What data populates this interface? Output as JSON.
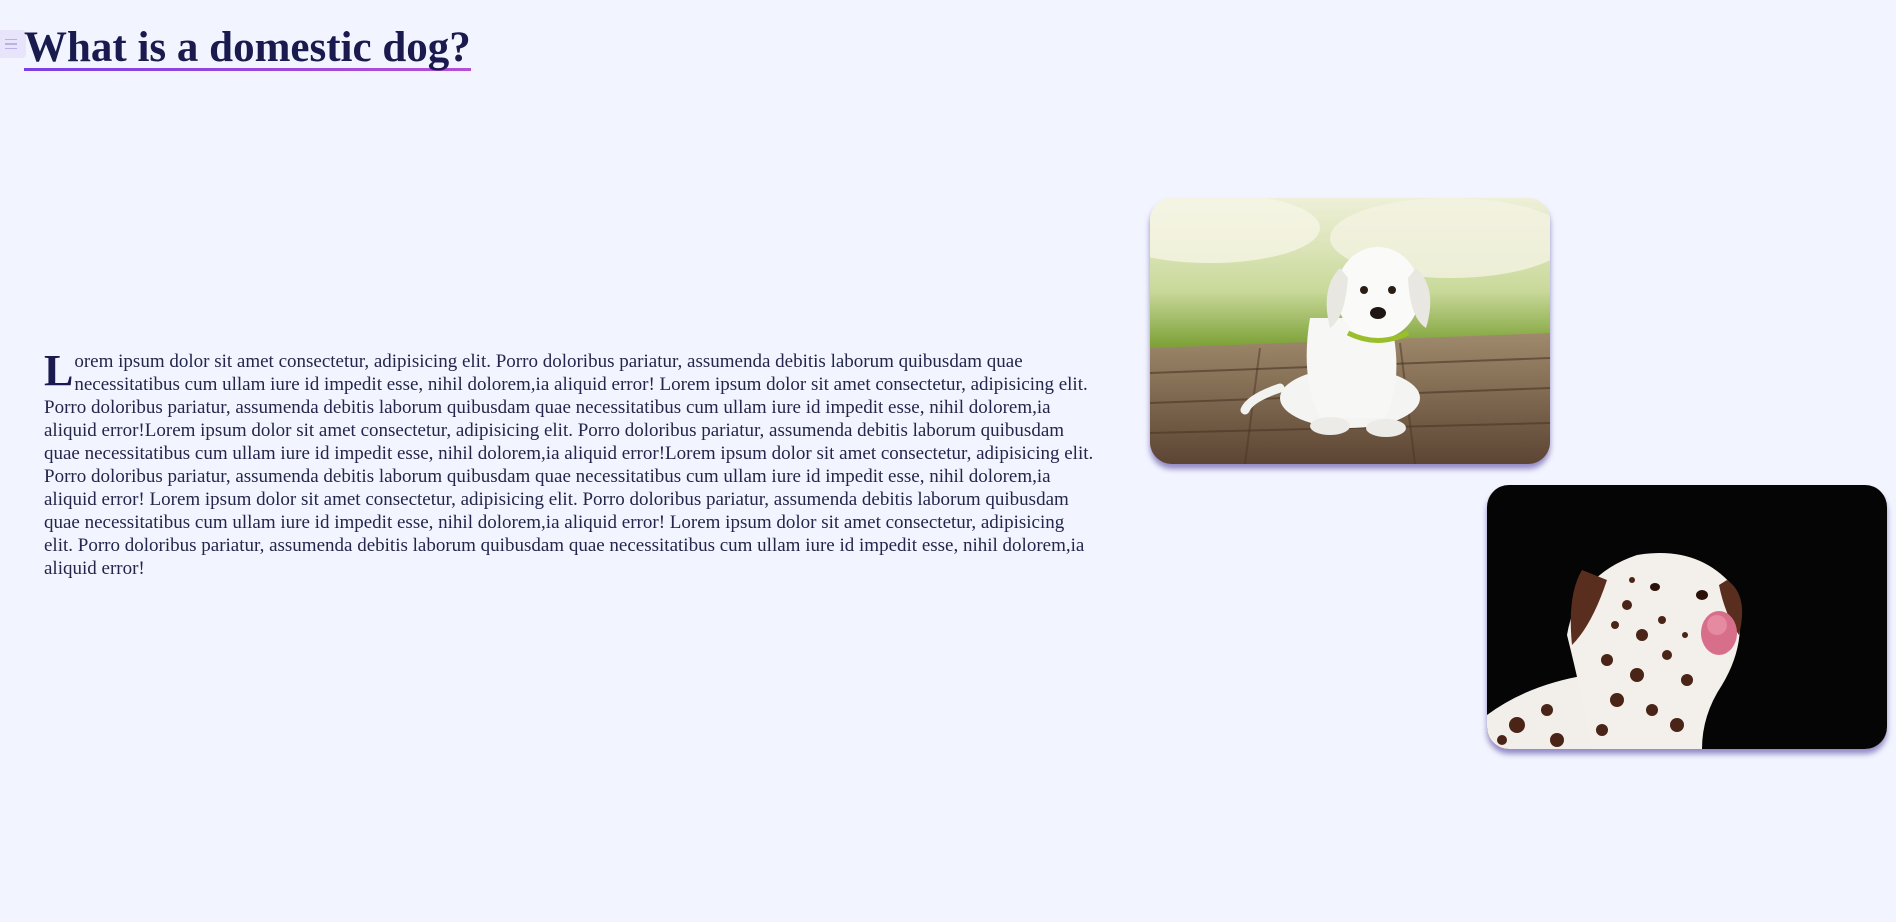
{
  "header": {
    "title": "What is a domestic dog?",
    "menu_icon": "hamburger-menu-icon"
  },
  "article": {
    "dropcap": "L",
    "paragraph": "orem ipsum dolor sit amet consectetur, adipisicing elit. Porro doloribus pariatur, assumenda debitis laborum quibusdam quae necessitatibus cum ullam iure id impedit esse, nihil dolorem,ia aliquid error! Lorem ipsum dolor sit amet consectetur, adipisicing elit. Porro doloribus pariatur, assumenda debitis laborum quibusdam quae necessitatibus cum ullam iure id impedit esse, nihil dolorem,ia aliquid error!Lorem ipsum dolor sit amet consectetur, adipisicing elit. Porro doloribus pariatur, assumenda debitis laborum quibusdam quae necessitatibus cum ullam iure id impedit esse, nihil dolorem,ia aliquid error!Lorem ipsum dolor sit amet consectetur, adipisicing elit. Porro doloribus pariatur, assumenda debitis laborum quibusdam quae necessitatibus cum ullam iure id impedit esse, nihil dolorem,ia aliquid error! Lorem ipsum dolor sit amet consectetur, adipisicing elit. Porro doloribus pariatur, assumenda debitis laborum quibusdam quae necessitatibus cum ullam iure id impedit esse, nihil dolorem,ia aliquid error! Lorem ipsum dolor sit amet consectetur, adipisicing elit. Porro doloribus pariatur, assumenda debitis laborum quibusdam quae necessitatibus cum ullam iure id impedit esse, nihil dolorem,ia aliquid error!"
  },
  "images": [
    {
      "subject": "white-puppy-photo"
    },
    {
      "subject": "dalmatian-photo"
    }
  ],
  "colors": {
    "background": "#f2f5ff",
    "title": "#1a1a4e",
    "underline": "#7b3fe4",
    "text": "#23264a"
  }
}
